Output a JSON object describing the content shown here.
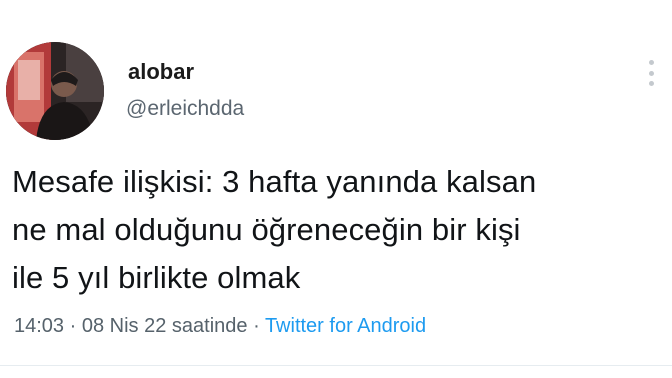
{
  "author": {
    "name": "alobar",
    "handle": "@erleichdda"
  },
  "icons": {
    "avatar": "avatar-photo",
    "more": "more-vertical-icon"
  },
  "tweet": {
    "lines": [
      "Mesafe ilişkisi: 3 hafta yanında kalsan",
      "ne mal olduğunu öğreneceğin bir kişi",
      "ile 5 yıl birlikte olmak"
    ]
  },
  "meta": {
    "time": "14:03",
    "separator1": " · ",
    "date": "08 Nis 22 saatinde",
    "separator2": " · ",
    "source": "Twitter for Android"
  },
  "colors": {
    "link": "#1d9bf0",
    "muted": "#5b6670"
  }
}
